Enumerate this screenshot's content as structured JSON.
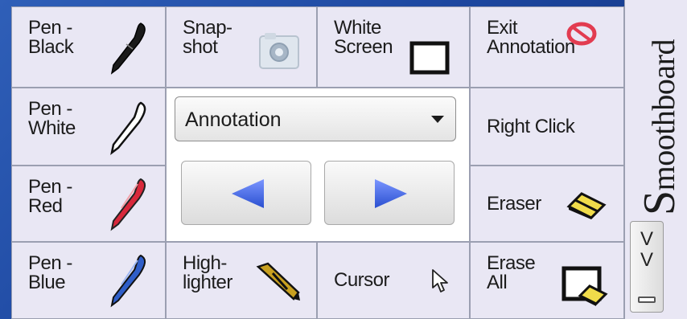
{
  "toolbar": {
    "pen_black": "Pen -\nBlack",
    "snapshot": "Snap-\nshot",
    "white_screen": "White\nScreen",
    "exit_annotation": "Exit\nAnnotation",
    "pen_white": "Pen -\nWhite",
    "right_click": "Right Click",
    "pen_red": "Pen -\nRed",
    "eraser": "Eraser",
    "pen_blue": "Pen -\nBlue",
    "highlighter": "High-\nlighter",
    "cursor": "Cursor",
    "erase_all": "Erase\nAll"
  },
  "mode_select": {
    "value": "Annotation"
  },
  "sidebar": {
    "brand_initial": "S",
    "brand_rest": "moothboard",
    "collapse_v1": "V",
    "collapse_v2": "V"
  },
  "colors": {
    "pen_black": "#1a1a1a",
    "pen_white": "#ffffff",
    "pen_red": "#d8283b",
    "pen_blue": "#2f5ec8",
    "nav_arrow": "#4466dd",
    "background": "#1d47a0"
  },
  "icons": [
    "pen-icon",
    "camera-icon",
    "white-screen-icon",
    "exit-icon",
    "eraser-icon",
    "highlighter-icon",
    "cursor-icon",
    "erase-all-icon",
    "arrow-left-icon",
    "arrow-right-icon",
    "chevron-down-icon"
  ]
}
